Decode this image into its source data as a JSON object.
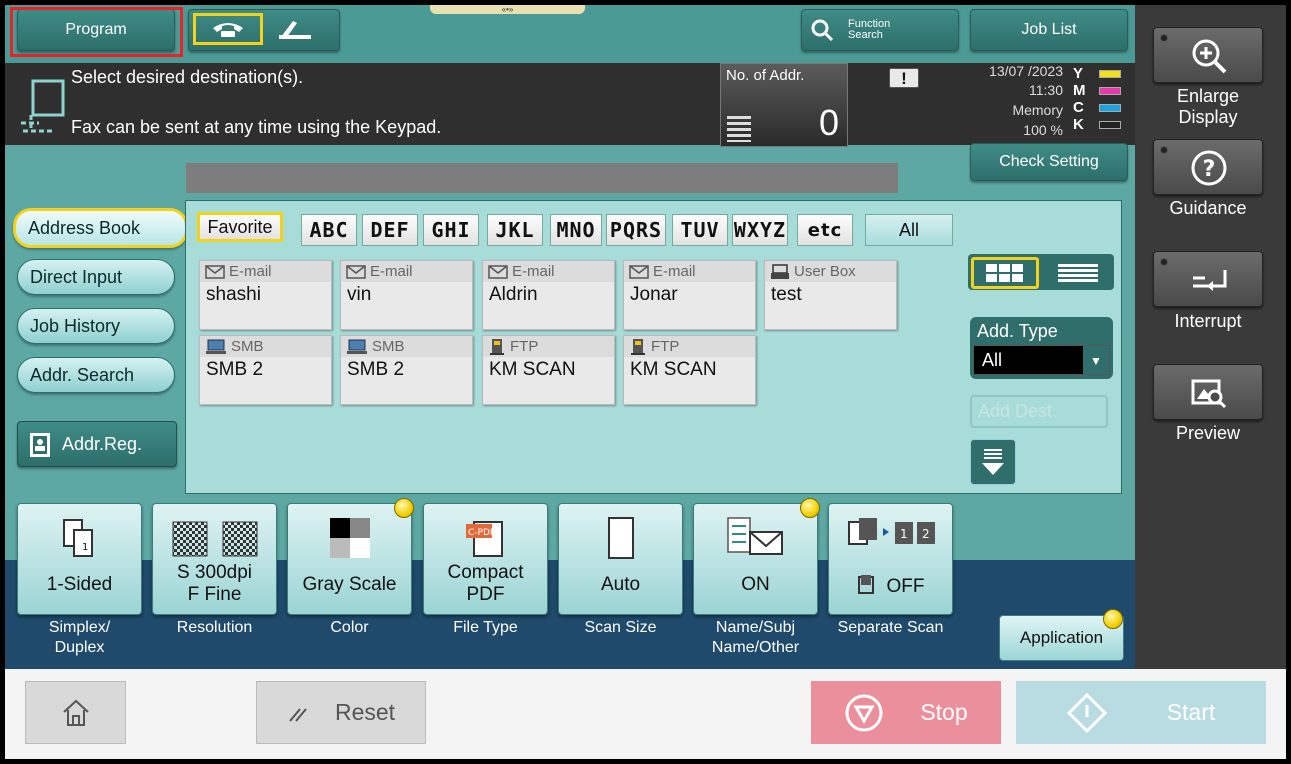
{
  "top": {
    "program_label": "Program",
    "function_search_line1": "Function",
    "function_search_line2": "Search",
    "job_list_label": "Job List"
  },
  "message": {
    "line1": "Select desired destination(s).",
    "line2": "Fax can be sent at any time using the Keypad."
  },
  "counter": {
    "label": "No. of Addr.",
    "value": "0"
  },
  "status": {
    "date": "13/07 /2023",
    "time": "11:30",
    "memory_label": "Memory",
    "memory_value": "100 %",
    "toner": [
      {
        "letter": "Y",
        "color": "#f3e21a"
      },
      {
        "letter": "M",
        "color": "#e23aa6"
      },
      {
        "letter": "C",
        "color": "#1aa3e0"
      },
      {
        "letter": "K",
        "color": "#222222"
      }
    ]
  },
  "check_setting_label": "Check Setting",
  "nav": {
    "address_book": "Address Book",
    "direct_input": "Direct Input",
    "job_history": "Job History",
    "addr_search": "Addr. Search",
    "addr_reg": "Addr.Reg."
  },
  "index_tabs": [
    "Favorite",
    "ABC",
    "DEF",
    "GHI",
    "JKL",
    "MNO",
    "PQRS",
    "TUV",
    "WXYZ",
    "etc",
    "All"
  ],
  "destinations": [
    {
      "type": "E-mail",
      "name": "shashi"
    },
    {
      "type": "E-mail",
      "name": "vin"
    },
    {
      "type": "E-mail",
      "name": "Aldrin"
    },
    {
      "type": "E-mail",
      "name": "Jonar"
    },
    {
      "type": "User Box",
      "name": "test"
    },
    {
      "type": "SMB",
      "name": "SMB 2"
    },
    {
      "type": "SMB",
      "name": "SMB 2"
    },
    {
      "type": "FTP",
      "name": "KM SCAN"
    },
    {
      "type": "FTP",
      "name": "KM SCAN"
    }
  ],
  "add_type": {
    "label": "Add. Type",
    "selected": "All",
    "add_dest_placeholder": "Add Dest."
  },
  "function_keys": [
    {
      "value": "1-Sided",
      "caption": "Simplex/\nDuplex",
      "changed": false
    },
    {
      "value": "S 300dpi\nF Fine",
      "caption": "Resolution",
      "changed": false
    },
    {
      "value": "Gray Scale",
      "caption": "Color",
      "changed": true
    },
    {
      "value": "Compact\nPDF",
      "caption": "File Type",
      "changed": false
    },
    {
      "value": "Auto",
      "caption": "Scan Size",
      "changed": false
    },
    {
      "value": "ON",
      "caption": "Name/Subj\nName/Other",
      "changed": true
    },
    {
      "value": "OFF",
      "caption": "Separate Scan",
      "changed": false
    }
  ],
  "application_label": "Application",
  "right_panel": {
    "enlarge_display": "Enlarge\nDisplay",
    "guidance": "Guidance",
    "interrupt": "Interrupt",
    "preview": "Preview"
  },
  "bottom": {
    "reset_label": "Reset",
    "stop_label": "Stop",
    "start_label": "Start"
  },
  "colors": {
    "stop_bg": "#ea8f9b",
    "start_bg": "#b9dce3",
    "highlight": "#e8242a"
  }
}
